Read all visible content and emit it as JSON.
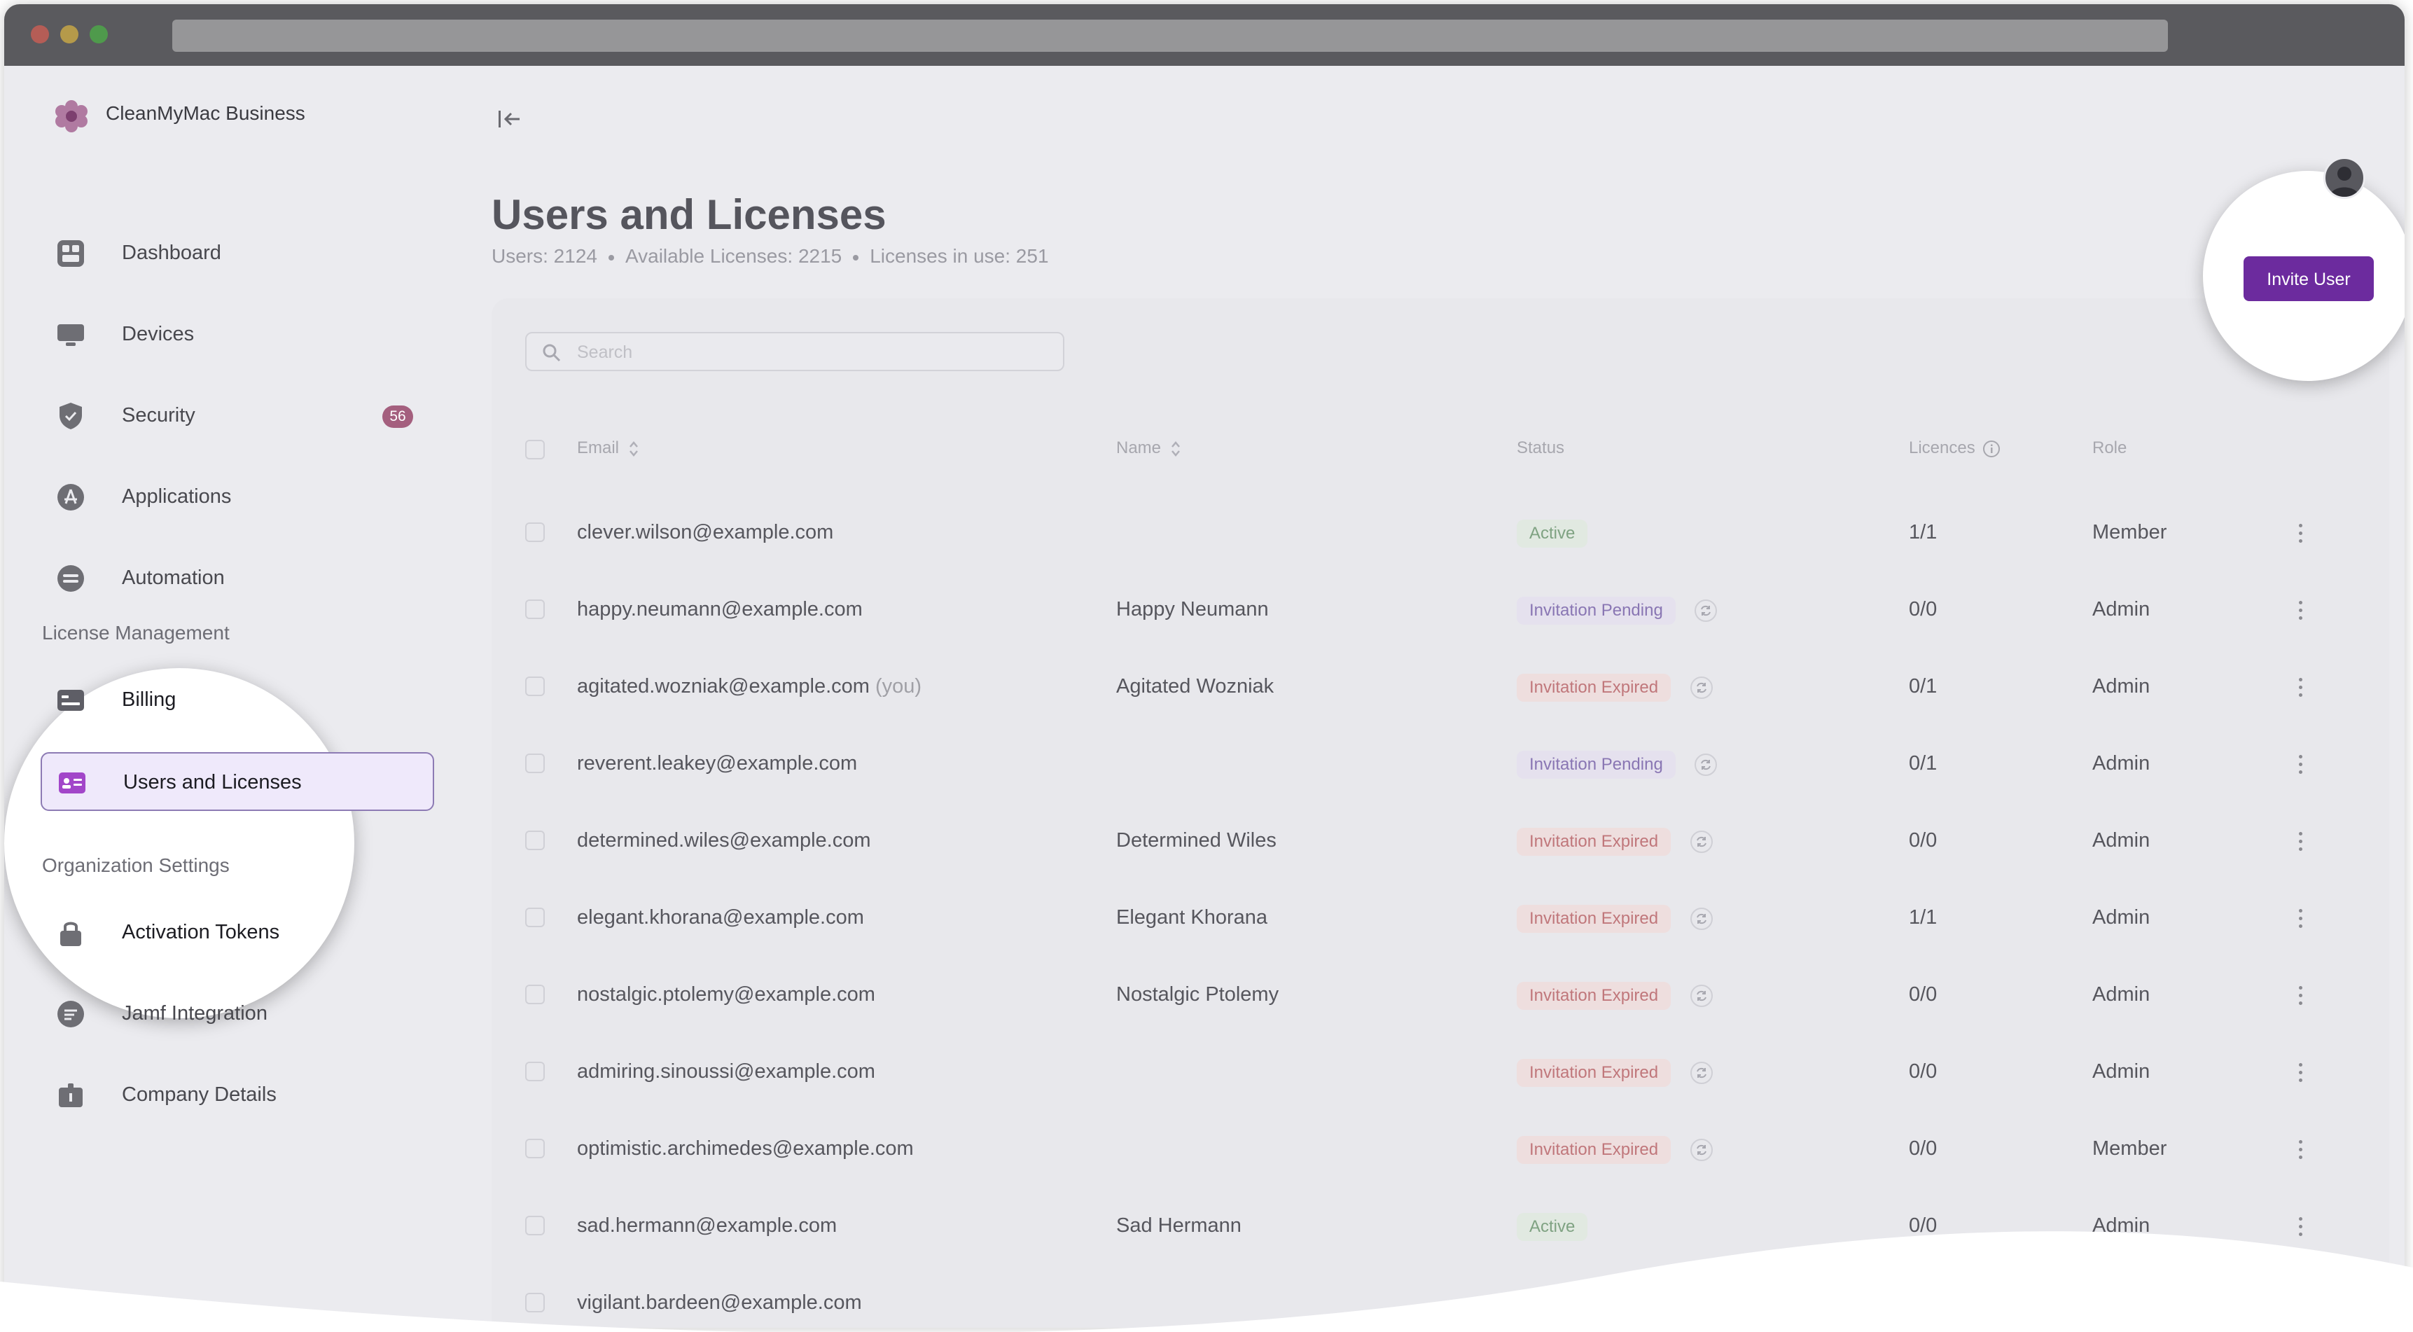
{
  "brand": {
    "name": "CleanMyMac Business"
  },
  "sidebar": {
    "items": [
      {
        "label": "Dashboard",
        "icon": "dashboard-icon"
      },
      {
        "label": "Devices",
        "icon": "monitor-icon"
      },
      {
        "label": "Security",
        "icon": "shield-icon",
        "badge": "56"
      },
      {
        "label": "Applications",
        "icon": "app-store-icon"
      },
      {
        "label": "Automation",
        "icon": "automation-icon"
      }
    ],
    "license_section": "License Management",
    "license_items": [
      {
        "label": "Billing",
        "icon": "billing-icon"
      },
      {
        "label": "Users and Licenses",
        "icon": "id-card-icon",
        "active": true
      }
    ],
    "org_section": "Organization Settings",
    "org_items": [
      {
        "label": "Activation Tokens",
        "icon": "lock-icon"
      },
      {
        "label": "Jamf Integration",
        "icon": "jamf-icon"
      },
      {
        "label": "Company Details",
        "icon": "company-icon"
      }
    ]
  },
  "page": {
    "title": "Users and Licenses",
    "users": "Users: 2124",
    "available": "Available Licenses: 2215",
    "in_use": "Licenses in use: 251"
  },
  "toolbar": {
    "invite_label": "Invite User"
  },
  "search": {
    "placeholder": "Search"
  },
  "table": {
    "headers": {
      "email": "Email",
      "name": "Name",
      "status": "Status",
      "licences": "Licences",
      "role": "Role"
    },
    "rows": [
      {
        "email": "clever.wilson@example.com",
        "you": "",
        "name": "",
        "status": "Active",
        "licences": "1/1",
        "role": "Member"
      },
      {
        "email": "happy.neumann@example.com",
        "you": "",
        "name": "Happy Neumann",
        "status": "Invitation Pending",
        "licences": "0/0",
        "role": "Admin"
      },
      {
        "email": "agitated.wozniak@example.com",
        "you": "(you)",
        "name": "Agitated Wozniak",
        "status": "Invitation Expired",
        "licences": "0/1",
        "role": "Admin"
      },
      {
        "email": "reverent.leakey@example.com",
        "you": "",
        "name": "",
        "status": "Invitation Pending",
        "licences": "0/1",
        "role": "Admin"
      },
      {
        "email": "determined.wiles@example.com",
        "you": "",
        "name": "Determined Wiles",
        "status": "Invitation Expired",
        "licences": "0/0",
        "role": "Admin"
      },
      {
        "email": "elegant.khorana@example.com",
        "you": "",
        "name": "Elegant Khorana",
        "status": "Invitation Expired",
        "licences": "1/1",
        "role": "Admin"
      },
      {
        "email": "nostalgic.ptolemy@example.com",
        "you": "",
        "name": "Nostalgic Ptolemy",
        "status": "Invitation Expired",
        "licences": "0/0",
        "role": "Admin"
      },
      {
        "email": "admiring.sinoussi@example.com",
        "you": "",
        "name": "",
        "status": "Invitation Expired",
        "licences": "0/0",
        "role": "Admin"
      },
      {
        "email": "optimistic.archimedes@example.com",
        "you": "",
        "name": "",
        "status": "Invitation Expired",
        "licences": "0/0",
        "role": "Member"
      },
      {
        "email": "sad.hermann@example.com",
        "you": "",
        "name": "Sad Hermann",
        "status": "Active",
        "licences": "0/0",
        "role": "Admin"
      },
      {
        "email": "vigilant.bardeen@example.com",
        "you": "",
        "name": "",
        "status": "",
        "licences": "",
        "role": ""
      }
    ]
  },
  "colors": {
    "accent": "#6c2b9e",
    "active_nav_bg": "#efe9fb",
    "badge": "#a45f7e"
  }
}
